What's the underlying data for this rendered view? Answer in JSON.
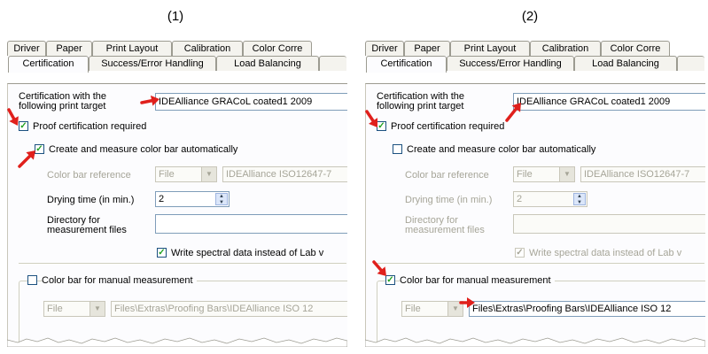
{
  "captions": [
    "(1)",
    "(2)"
  ],
  "panels": [
    {
      "tabs_row1": [
        "Driver",
        "Paper",
        "Print Layout",
        "Calibration",
        "Color Corre"
      ],
      "tabs_row2": [
        "Certification",
        "Success/Error Handling",
        "Load Balancing"
      ],
      "cert_label_line1": "Certification with the",
      "cert_label_line2": "following print target",
      "print_target_value": "IDEAlliance GRACoL coated1 2009",
      "proof_cert_label": "Proof certification required",
      "proof_cert_checked": true,
      "create_measure_label": "Create and measure color bar automatically",
      "create_measure_checked": true,
      "color_bar_ref_label": "Color bar reference",
      "color_bar_ref_type": "File",
      "color_bar_ref_value": "IDEAlliance ISO12647-7",
      "drying_time_label": "Drying time (in min.)",
      "drying_time_value": "2",
      "directory_label_line1": "Directory for",
      "directory_label_line2": "measurement files",
      "directory_value": "",
      "write_spectral_label": "Write spectral data instead of Lab v",
      "write_spectral_checked": true,
      "manual_label": "Color bar for manual measurement",
      "manual_checked": false,
      "manual_type": "File",
      "manual_path": "Files\\Extras\\Proofing Bars\\IDEAlliance ISO 12"
    },
    {
      "tabs_row1": [
        "Driver",
        "Paper",
        "Print Layout",
        "Calibration",
        "Color Corre"
      ],
      "tabs_row2": [
        "Certification",
        "Success/Error Handling",
        "Load Balancing"
      ],
      "cert_label_line1": "Certification with the",
      "cert_label_line2": "following print target",
      "print_target_value": "IDEAlliance GRACoL coated1 2009",
      "proof_cert_label": "Proof certification required",
      "proof_cert_checked": true,
      "create_measure_label": "Create and measure color bar automatically",
      "create_measure_checked": false,
      "color_bar_ref_label": "Color bar reference",
      "color_bar_ref_type": "File",
      "color_bar_ref_value": "IDEAlliance ISO12647-7",
      "drying_time_label": "Drying time (in min.)",
      "drying_time_value": "2",
      "directory_label_line1": "Directory for",
      "directory_label_line2": "measurement files",
      "directory_value": "",
      "write_spectral_label": "Write spectral data instead of Lab v",
      "write_spectral_checked": true,
      "manual_label": "Color bar for manual measurement",
      "manual_checked": true,
      "manual_type": "File",
      "manual_path": "Files\\Extras\\Proofing Bars\\IDEAlliance ISO 12"
    }
  ],
  "colors": {
    "arrow": "#e0201c",
    "check": "#21a121",
    "dialog_bg": "#fcfcfe",
    "tab_bg": "#f4f3ee"
  },
  "icons": {
    "check": "checkmark-icon",
    "arrow": "red-arrow-icon",
    "combo": "chevron-down-icon",
    "spin": "spinner-icon"
  }
}
